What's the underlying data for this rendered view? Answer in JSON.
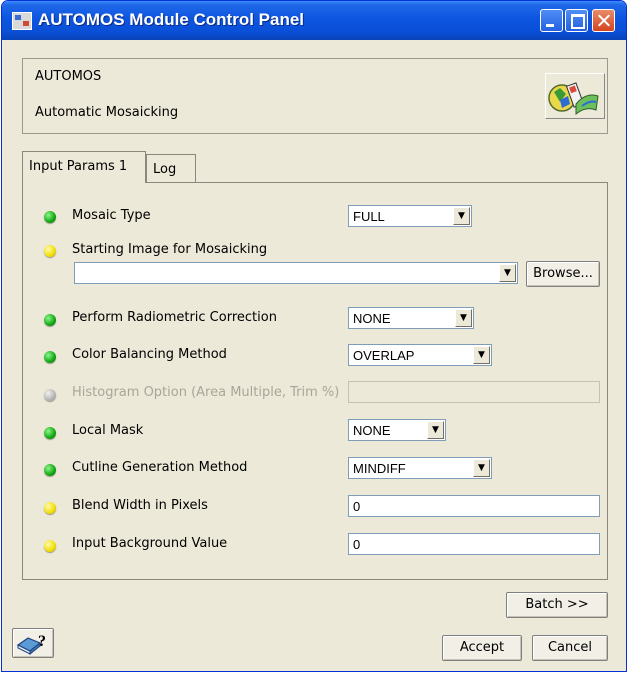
{
  "window": {
    "title": "AUTOMOS Module Control Panel"
  },
  "header": {
    "module_name": "AUTOMOS",
    "module_description": "Automatic Mosaicking"
  },
  "tabs": [
    {
      "label": "Input Params 1",
      "active": true
    },
    {
      "label": "Log",
      "active": false
    }
  ],
  "params": {
    "mosaic_type": {
      "label": "Mosaic Type",
      "status": "green",
      "value": "FULL"
    },
    "starting_image": {
      "label": "Starting Image for Mosaicking",
      "status": "yellow",
      "value": "",
      "browse_label": "Browse..."
    },
    "radiometric": {
      "label": "Perform Radiometric Correction",
      "status": "green",
      "value": "NONE"
    },
    "color_balancing": {
      "label": "Color Balancing Method",
      "status": "green",
      "value": "OVERLAP"
    },
    "histogram": {
      "label": "Histogram Option (Area Multiple, Trim %)",
      "status": "gray",
      "value": "",
      "disabled": true
    },
    "local_mask": {
      "label": "Local Mask",
      "status": "green",
      "value": "NONE"
    },
    "cutline": {
      "label": "Cutline Generation Method",
      "status": "green",
      "value": "MINDIFF"
    },
    "blend_width": {
      "label": "Blend Width in Pixels",
      "status": "yellow",
      "value": "0"
    },
    "background": {
      "label": "Input Background Value",
      "status": "yellow",
      "value": "0"
    }
  },
  "buttons": {
    "batch": "Batch >>",
    "accept": "Accept",
    "cancel": "Cancel",
    "help_glyph": "?"
  },
  "colors": {
    "status_green": "#11a811",
    "status_yellow": "#f2e000",
    "status_gray": "#b5b5b5",
    "titlebar": "#0a4fd6"
  }
}
